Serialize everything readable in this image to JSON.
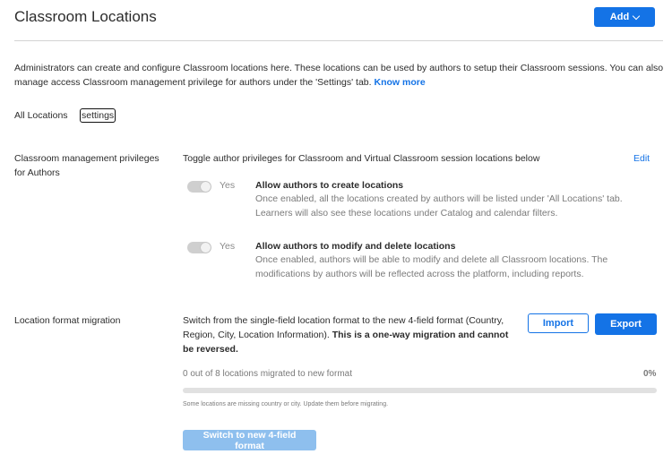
{
  "header": {
    "title": "Classroom Locations",
    "add_label": "Add"
  },
  "intro": {
    "text": "Administrators can create and configure Classroom locations here. These locations can be used by authors to setup their Classroom sessions. You can also manage access Classroom management privilege for authors under the 'Settings' tab. ",
    "know_more": "Know more"
  },
  "tabs": [
    {
      "label": "All Locations"
    },
    {
      "label": "settings"
    }
  ],
  "privileges": {
    "label": "Classroom management privileges for Authors",
    "description": "Toggle author privileges for Classroom and Virtual Classroom session locations below",
    "edit_label": "Edit",
    "items": [
      {
        "toggle_label": "Yes",
        "enabled": true,
        "title": "Allow authors to create locations",
        "description": "Once enabled, all the locations created by authors will be listed under 'All Locations' tab. Learners will also see these locations under Catalog and calendar filters."
      },
      {
        "toggle_label": "Yes",
        "enabled": true,
        "title": "Allow authors to modify and delete locations",
        "description": "Once enabled, authors will be able to modify and delete all Classroom locations. The modifications by authors will be reflected across the platform, including reports."
      }
    ]
  },
  "migration": {
    "label": "Location format migration",
    "description": "Switch from the single-field location format to the new 4-field format (Country, Region, City, Location Information). ",
    "description_bold": "This is a one-way migration and cannot be reversed.",
    "import_label": "Import",
    "export_label": "Export",
    "progress_text": "0 out of 8 locations migrated to new format",
    "progress_percent_label": "0%",
    "progress_fraction": 0,
    "warning": "Some locations are missing country or city. Update them before migrating.",
    "switch_label": "Switch to new 4-field format"
  },
  "colors": {
    "accent": "#1473e6",
    "disabled_accent": "#8ebfee",
    "toggle_track": "#cfcfcf"
  },
  "icons": {
    "add_dropdown": "chevron-down-icon"
  }
}
